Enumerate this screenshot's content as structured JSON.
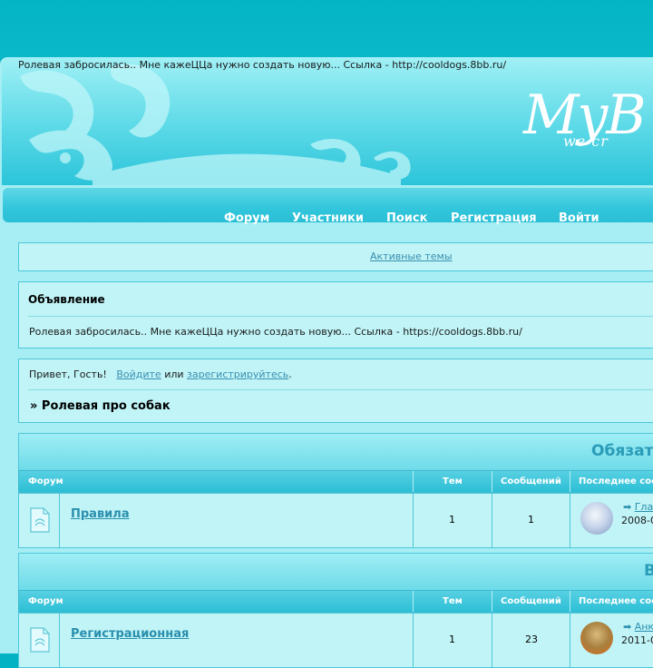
{
  "header": {
    "announcement": "Ролевая забросилась.. Мне кажеЦЦа нужно создать новую... Ссылка - http://cooldogs.8bb.ru/",
    "logo_text": "MyB",
    "logo_sub": "we cr"
  },
  "nav": {
    "items": [
      "Форум",
      "Участники",
      "Поиск",
      "Регистрация",
      "Войти"
    ]
  },
  "active_topics": {
    "label": "Активные темы"
  },
  "announcement_box": {
    "title": "Объявление",
    "text": "Ролевая забросилась.. Мне кажеЦЦа нужно создать новую... Ссылка - https://cooldogs.8bb.ru/"
  },
  "greeting": {
    "prefix": "Привет, Гость!",
    "login_link": "Войдите",
    "or": "или",
    "register_link": "зарегистрируйтесь",
    "suffix": ".",
    "breadcrumb": "» Ролевая про собак"
  },
  "categories": [
    {
      "title": "Обязате",
      "columns": [
        "Форум",
        "Тем",
        "Сообщений",
        "Последнее соо"
      ],
      "rows": [
        {
          "name": "Правила",
          "topics": "1",
          "posts": "1",
          "last_link": "Гла",
          "last_date": "2008-0",
          "avatar_colors": [
            "#9fb8d8",
            "#e8eef6"
          ]
        }
      ]
    },
    {
      "title": "В",
      "columns": [
        "Форум",
        "Тем",
        "Сообщений",
        "Последнее соо"
      ],
      "rows": [
        {
          "name": "Регистрационная",
          "topics": "1",
          "posts": "23",
          "last_link": "Анк",
          "last_date": "2011-0",
          "avatar_colors": [
            "#b08a4a",
            "#e07a2a"
          ]
        }
      ]
    }
  ],
  "colors": {
    "accent": "#2a9cb8",
    "link": "#3b8fb0",
    "page_bg": "#a6eef4",
    "top_bg": "#03b3c3"
  }
}
